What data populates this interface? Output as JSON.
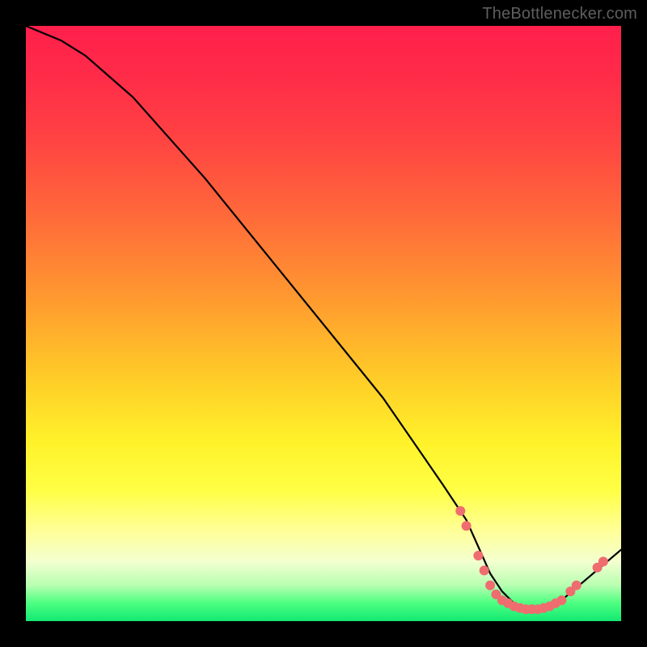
{
  "watermark": "TheBottlenecker.com",
  "chart_data": {
    "type": "line",
    "title": "",
    "xlabel": "",
    "ylabel": "",
    "xlim": [
      0,
      100
    ],
    "ylim": [
      0,
      100
    ],
    "series": [
      {
        "name": "curve",
        "x": [
          0,
          6,
          10,
          18,
          30,
          45,
          60,
          70,
          74,
          76,
          78,
          80,
          82,
          84,
          86,
          88,
          90,
          100
        ],
        "values": [
          100,
          97.5,
          95,
          88,
          74.5,
          56,
          37.5,
          23,
          17,
          12.5,
          8,
          5,
          3,
          2,
          2,
          2.5,
          3.5,
          12
        ]
      }
    ],
    "markers": [
      {
        "x": 73,
        "y": 18.5
      },
      {
        "x": 74,
        "y": 16
      },
      {
        "x": 76,
        "y": 11
      },
      {
        "x": 77,
        "y": 8.5
      },
      {
        "x": 78,
        "y": 6
      },
      {
        "x": 79,
        "y": 4.5
      },
      {
        "x": 80,
        "y": 3.5
      },
      {
        "x": 81,
        "y": 3
      },
      {
        "x": 82,
        "y": 2.5
      },
      {
        "x": 83,
        "y": 2.2
      },
      {
        "x": 84,
        "y": 2
      },
      {
        "x": 85,
        "y": 2
      },
      {
        "x": 86,
        "y": 2
      },
      {
        "x": 87,
        "y": 2.2
      },
      {
        "x": 88,
        "y": 2.5
      },
      {
        "x": 89,
        "y": 3
      },
      {
        "x": 90,
        "y": 3.5
      },
      {
        "x": 91.5,
        "y": 5
      },
      {
        "x": 92.5,
        "y": 6
      },
      {
        "x": 96,
        "y": 9
      },
      {
        "x": 97,
        "y": 10
      }
    ],
    "marker_color": "#ef6c6f",
    "gradient_stops": [
      {
        "pos": 0,
        "color": "#ff1f4b"
      },
      {
        "pos": 8,
        "color": "#ff2b49"
      },
      {
        "pos": 18,
        "color": "#ff4043"
      },
      {
        "pos": 32,
        "color": "#ff6a3a"
      },
      {
        "pos": 46,
        "color": "#ff9a2f"
      },
      {
        "pos": 58,
        "color": "#ffc828"
      },
      {
        "pos": 70,
        "color": "#fff22a"
      },
      {
        "pos": 78,
        "color": "#ffff45"
      },
      {
        "pos": 85,
        "color": "#ffff9a"
      },
      {
        "pos": 90,
        "color": "#f3ffcf"
      },
      {
        "pos": 94,
        "color": "#b7ffb1"
      },
      {
        "pos": 97,
        "color": "#4cff80"
      },
      {
        "pos": 100,
        "color": "#12e873"
      }
    ]
  }
}
